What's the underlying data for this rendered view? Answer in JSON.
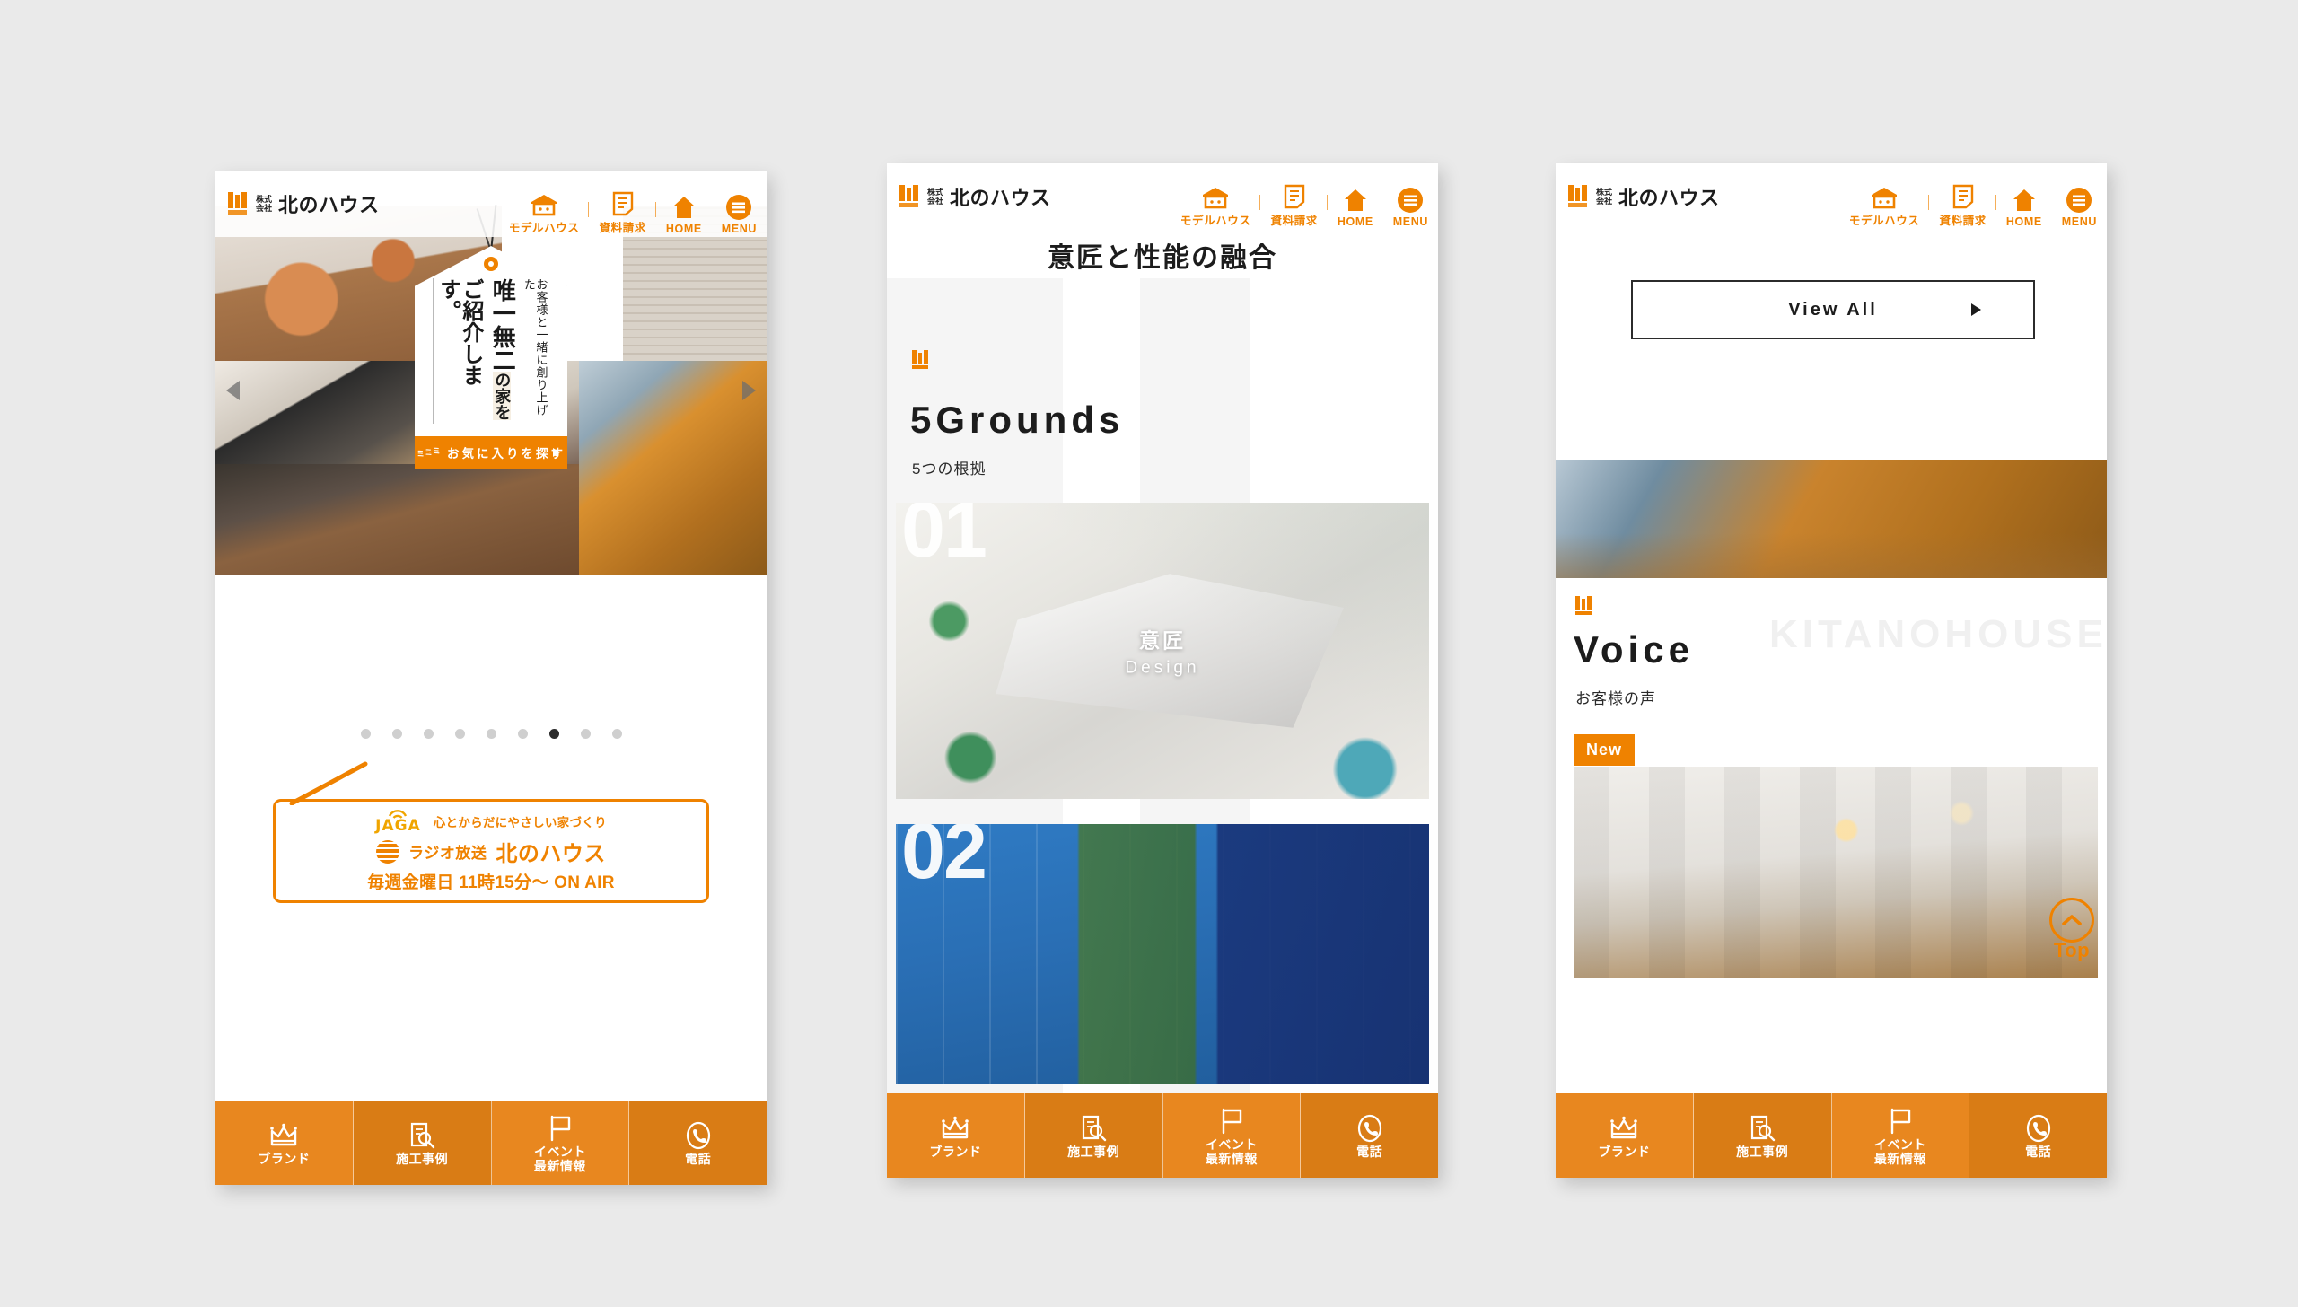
{
  "header": {
    "company_prefix": "株式会社",
    "company_name": "北のハウス",
    "nav": [
      {
        "label": "モデルハウス",
        "icon": "house-shop-icon"
      },
      {
        "label": "資料請求",
        "icon": "document-icon"
      },
      {
        "label": "HOME",
        "icon": "home-icon"
      },
      {
        "label": "MENU",
        "icon": "hamburger-icon"
      }
    ]
  },
  "phone1": {
    "tag": {
      "line_small": "お客様と一緒に創り上げた",
      "line_main": "唯一無二",
      "line_main_suffix": "の家を",
      "line_last": "ご紹介します。",
      "button_label": "お気に入りを探す",
      "button_wave": "ミミミ"
    },
    "carousel": {
      "prev": "◀",
      "next": "▶",
      "dot_count": 9,
      "active_dot": 7
    },
    "radio": {
      "station": "JAGA",
      "tagline": "心とからだにやさしい家づくり",
      "broadcast_label": "ラジオ放送",
      "program": "北のハウス",
      "schedule": "毎週金曜日 11時15分〜 ON AIR"
    }
  },
  "phone2": {
    "page_title": "意匠と性能の融合",
    "section": {
      "title_en": "5Grounds",
      "title_jp": "5つの根拠"
    },
    "cards": [
      {
        "number": "01",
        "jp": "意匠",
        "en": "Design"
      },
      {
        "number": "02",
        "jp": "",
        "en": ""
      }
    ]
  },
  "phone3": {
    "view_all": "View All",
    "section": {
      "title_en": "Voice",
      "title_jp": "お客様の声",
      "watermark": "KITANOHOUSE"
    },
    "badge_new": "New",
    "top_button": "Top"
  },
  "bottom_nav": [
    {
      "label": "ブランド",
      "icon": "crown-icon"
    },
    {
      "label": "施工事例",
      "icon": "document-search-icon"
    },
    {
      "label": "イベント\n最新情報",
      "icon": "flag-icon"
    },
    {
      "label": "電話",
      "icon": "phone-icon"
    }
  ],
  "colors": {
    "brand_orange": "#ef8200",
    "nav_orange_a": "#e8871f",
    "nav_orange_b": "#d97c15",
    "page_bg": "#eaeaea",
    "text_dark": "#1c1c1c"
  }
}
